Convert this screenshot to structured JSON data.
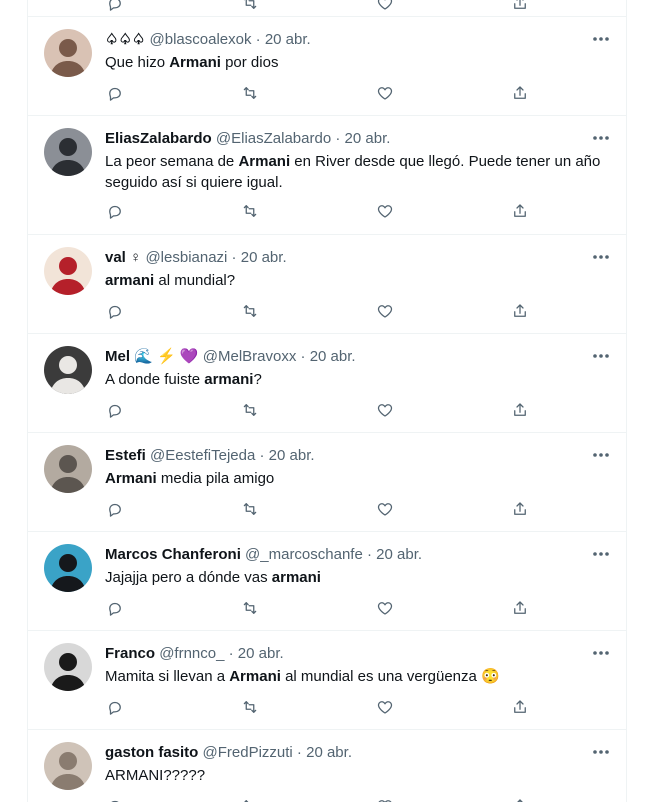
{
  "tweets": [
    {
      "name": "♤♤♤",
      "handle": "@blascoalexok",
      "date": "20 abr.",
      "text": [
        {
          "t": "Que hizo "
        },
        {
          "t": "Armani",
          "b": true
        },
        {
          "t": " por dios"
        }
      ],
      "avatar_colors": [
        "#7a5a4a",
        "#d9c2b4"
      ]
    },
    {
      "name": "EliasZalabardo",
      "handle": "@EliasZalabardo",
      "date": "20 abr.",
      "text": [
        {
          "t": "La peor semana de "
        },
        {
          "t": "Armani",
          "b": true
        },
        {
          "t": " en River desde que llegó. Puede tener un año seguido así si quiere igual."
        }
      ],
      "avatar_colors": [
        "#2b2e33",
        "#8b8f96"
      ],
      "tall": true
    },
    {
      "name": "val ♀",
      "handle": "@lesbianazi",
      "date": "20 abr.",
      "text": [
        {
          "t": "armani",
          "b": true
        },
        {
          "t": " al mundial?"
        }
      ],
      "avatar_colors": [
        "#b5202a",
        "#f2e4d8"
      ]
    },
    {
      "name": "Mel",
      "name_emojis": [
        "🌊",
        "⚡",
        "💜"
      ],
      "handle": "@MelBravoxx",
      "date": "20 abr.",
      "text": [
        {
          "t": "A donde fuiste "
        },
        {
          "t": "armani",
          "b": true
        },
        {
          "t": "?"
        }
      ],
      "avatar_colors": [
        "#e9e7e4",
        "#3b3b3b"
      ]
    },
    {
      "name": "Estefi",
      "handle": "@EestefiTejeda",
      "date": "20 abr.",
      "text": [
        {
          "t": "Armani",
          "b": true
        },
        {
          "t": " media pila amigo"
        }
      ],
      "avatar_colors": [
        "#5c5650",
        "#b3aaa0"
      ]
    },
    {
      "name": "Marcos Chanferoni",
      "handle": "@_marcoschanfe",
      "date": "20 abr.",
      "text": [
        {
          "t": "Jajajja pero a dónde vas "
        },
        {
          "t": "armani",
          "b": true
        }
      ],
      "avatar_colors": [
        "#15181c",
        "#3aa3c7"
      ]
    },
    {
      "name": "Franco",
      "handle": "@frnnco_",
      "date": "20 abr.",
      "text": [
        {
          "t": "Mamita si llevan a "
        },
        {
          "t": "Armani",
          "b": true
        },
        {
          "t": " al mundial es una vergüenza 😳"
        }
      ],
      "avatar_colors": [
        "#1a1a1a",
        "#d8d8d8"
      ]
    },
    {
      "name": "gaston fasito",
      "handle": "@FredPizzuti",
      "date": "20 abr.",
      "text": [
        {
          "t": "ARMANI?????"
        }
      ],
      "avatar_colors": [
        "#8a7c70",
        "#cfc3b8"
      ]
    }
  ],
  "icons": {
    "reply": "reply-icon",
    "retweet": "retweet-icon",
    "like": "heart-icon",
    "share": "share-icon",
    "more": "more-icon"
  },
  "colors": {
    "text": "#0f1419",
    "muted": "#536471",
    "border": "#eff3f4"
  }
}
